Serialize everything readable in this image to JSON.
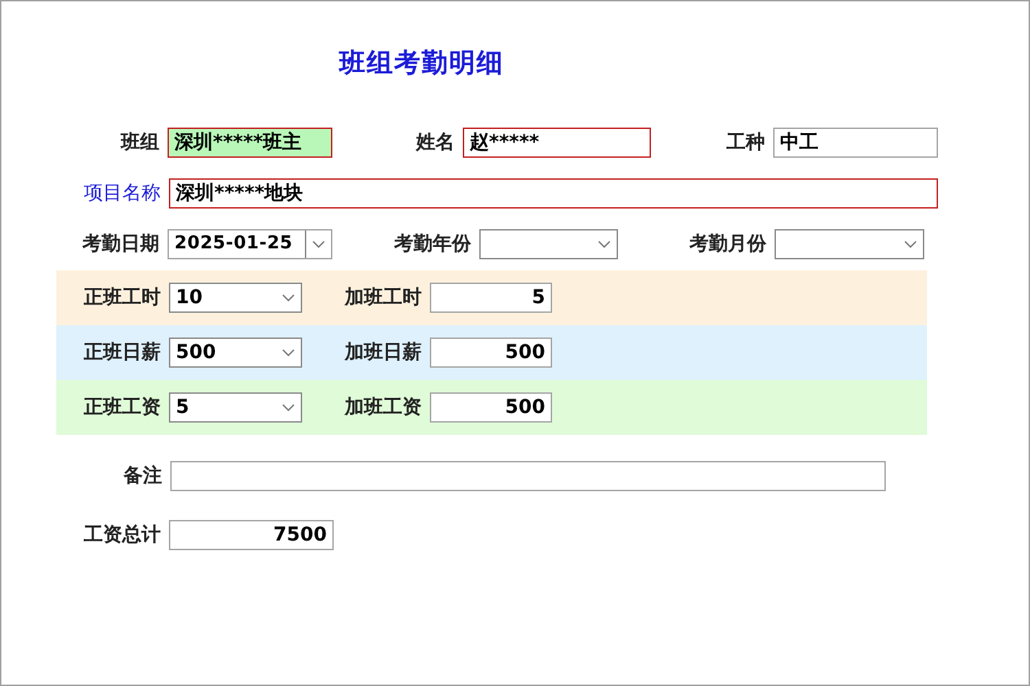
{
  "title": "班组考勤明细",
  "rows": [
    {
      "fields": [
        {
          "label": "班组",
          "value": "深圳*****班主",
          "kind": "text",
          "required": true,
          "highlighted": true
        },
        {
          "label": "姓名",
          "value": "赵*****",
          "kind": "text",
          "required": true,
          "highlighted": false
        },
        {
          "label": "工种",
          "value": "中工",
          "kind": "text",
          "required": false,
          "highlighted": false
        }
      ]
    },
    {
      "fields": [
        {
          "label": "项目名称",
          "value": "深圳*****地块",
          "kind": "text",
          "required": true,
          "highlighted": false,
          "label_accent": true
        }
      ]
    },
    {
      "fields": [
        {
          "label": "考勤日期",
          "value": "2025-01-25",
          "kind": "date",
          "required": false,
          "highlighted": false
        },
        {
          "label": "考勤年份",
          "kind": "combo",
          "required": false,
          "highlighted": false
        },
        {
          "label": "考勤月份",
          "kind": "combo",
          "required": false,
          "highlighted": false
        }
      ]
    },
    {
      "color": "#fdf1de",
      "fields": [
        {
          "label": "正班工时",
          "value": "10",
          "kind": "combo",
          "required": false,
          "highlighted": false
        },
        {
          "label": "加班工时",
          "value": "5",
          "kind": "number",
          "required": false,
          "highlighted": false
        }
      ]
    },
    {
      "color": "#dff1fc",
      "fields": [
        {
          "label": "正班日薪",
          "value": "500",
          "kind": "combo",
          "required": false,
          "highlighted": false
        },
        {
          "label": "加班日薪",
          "value": "500",
          "kind": "number",
          "required": false,
          "highlighted": false
        }
      ]
    },
    {
      "color": "#e0fbd8",
      "fields": [
        {
          "label": "正班工资",
          "value": "5",
          "kind": "combo",
          "required": false,
          "highlighted": false
        },
        {
          "label": "加班工资",
          "value": "500",
          "kind": "number",
          "required": false,
          "highlighted": false
        }
      ]
    },
    {
      "fields": [
        {
          "label": "备注",
          "kind": "text",
          "required": false,
          "highlighted": false
        }
      ]
    },
    {
      "fields": [
        {
          "label": "工资总计",
          "value": "7500",
          "kind": "number",
          "required": false,
          "highlighted": false
        }
      ]
    }
  ]
}
